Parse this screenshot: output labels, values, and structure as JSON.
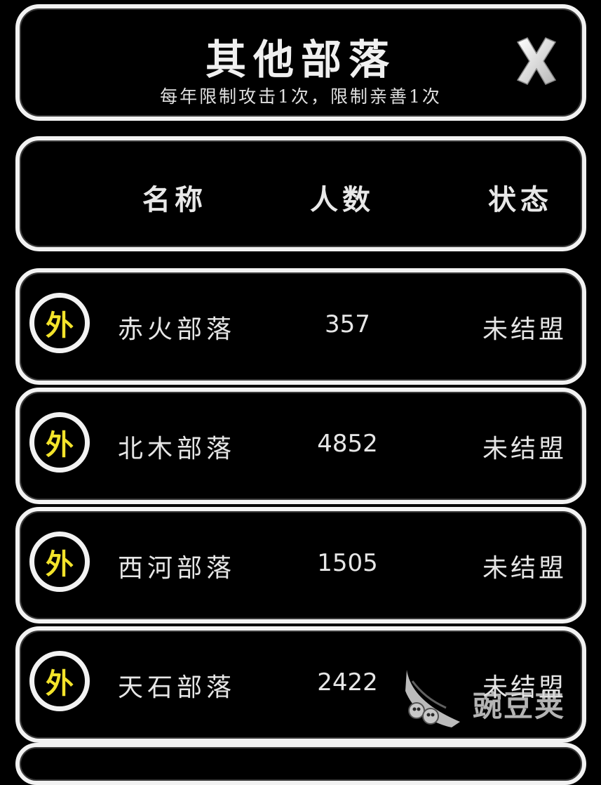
{
  "header": {
    "title": "其他部落",
    "subtitle": "每年限制攻击1次，限制亲善1次",
    "close_icon": "close-x-icon"
  },
  "columns": {
    "name": "名称",
    "count": "人数",
    "status": "状态"
  },
  "tribes": [
    {
      "badge": "外",
      "name": "赤火部落",
      "count": "357",
      "status": "未结盟"
    },
    {
      "badge": "外",
      "name": "北木部落",
      "count": "4852",
      "status": "未结盟"
    },
    {
      "badge": "外",
      "name": "西河部落",
      "count": "1505",
      "status": "未结盟"
    },
    {
      "badge": "外",
      "name": "天石部落",
      "count": "2422",
      "status": "未结盟"
    }
  ],
  "watermark": {
    "text": "豌豆荚",
    "icon": "pea-pod-logo-icon"
  },
  "colors": {
    "background": "#000000",
    "border": "#f2f2f2",
    "badge_text": "#f3e32a"
  }
}
